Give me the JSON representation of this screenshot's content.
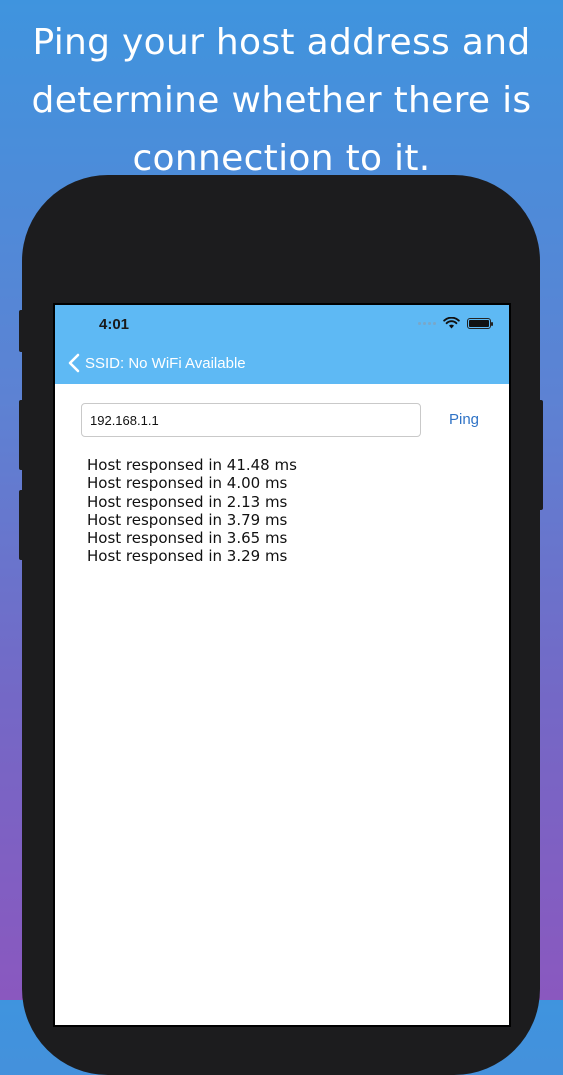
{
  "promo": {
    "headline_lines": [
      "Ping your host address and",
      "determine whether there is",
      "connection to it."
    ]
  },
  "status_bar": {
    "time": "4:01",
    "icons": [
      "signal-dots-icon",
      "wifi-icon",
      "battery-icon"
    ]
  },
  "nav": {
    "back_label": "SSID: No WiFi Available",
    "back_icon": "chevron-left-icon",
    "bar_color": "#5eb9f4"
  },
  "ping": {
    "host_value": "192.168.1.1",
    "button_label": "Ping",
    "button_color": "#2f73c6"
  },
  "results": [
    "Host responsed in 41.48 ms",
    "Host responsed in 4.00 ms",
    "Host responsed in 2.13 ms",
    "Host responsed in 3.79 ms",
    "Host responsed in 3.65 ms",
    "Host responsed in 3.29 ms"
  ]
}
